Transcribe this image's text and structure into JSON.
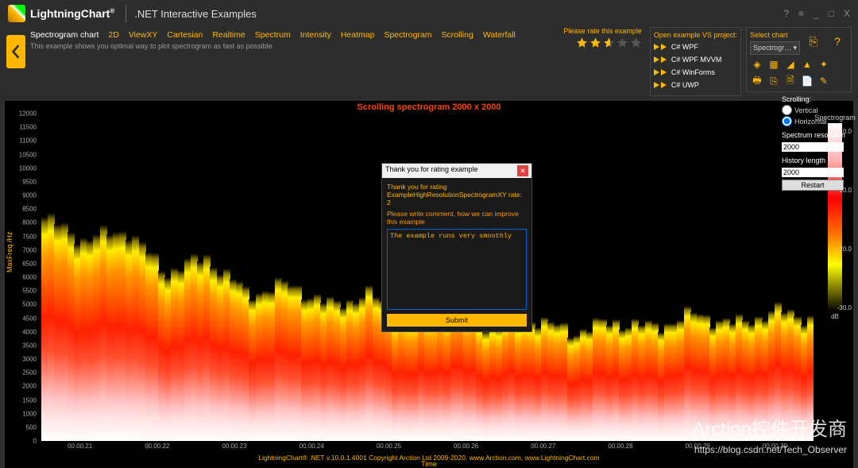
{
  "header": {
    "brand": "LightningChart",
    "brand_sup": "®",
    "app_title": ".NET Interactive Examples",
    "win": [
      "?",
      "≡",
      "_",
      "□",
      "X"
    ]
  },
  "crumbs": [
    "Spectrogram chart",
    "2D",
    "ViewXY",
    "Cartesian",
    "Realtime",
    "Spectrum",
    "Intensity",
    "Heatmap",
    "Spectrogram",
    "Scrolling",
    "Waterfall"
  ],
  "subtitle": "This example shows you optimal way to plot spectrogram as fast as possible.",
  "rating": {
    "label": "Please rate this example",
    "stars": [
      1,
      1,
      0.6,
      0,
      0
    ]
  },
  "open_project": {
    "hdr": "Open example VS project:",
    "opts": [
      "C# WPF",
      "C# WPF MVVM",
      "C# WinForms",
      "C# UWP"
    ]
  },
  "select_chart": {
    "hdr": "Select chart",
    "value": "Spectrogr…"
  },
  "side": {
    "scrolling_label": "Scrolling:",
    "opt1": "Vertical",
    "opt2": "Horizontal",
    "selected": "Horizontal",
    "spec_res_label": "Spectrum resolution",
    "spec_res": "2000",
    "hist_label": "History length",
    "hist": "2000",
    "restart": "Restart"
  },
  "dialog": {
    "title": "Thank you for rating example",
    "line1": "Thank you for rating ExampleHighResolutionSpectrogramXY rate: 2",
    "line2": "Please write comment, how we can improve this example",
    "text": "The example runs very smoothly",
    "submit": "Submit"
  },
  "footer": "LightningChart® .NET v.10.0.1.4001 Copyright Arction Ltd 2009-2020. www.Arction.com, www.LightningChart.com",
  "watermark1": "Arction控件开发商",
  "watermark2": "https://blog.csdn.net/Tech_Observer",
  "chart_data": {
    "type": "heatmap",
    "title": "Scrolling spectrogram 2000 x 2000",
    "xlabel": "Time",
    "ylabel": "MaxFreq /Hz",
    "y_ticks": [
      0,
      500,
      1000,
      1500,
      2000,
      2500,
      3000,
      3500,
      4000,
      4500,
      5000,
      5500,
      6000,
      6500,
      7000,
      7500,
      8000,
      8500,
      9000,
      9500,
      10000,
      10500,
      11000,
      11500,
      12000
    ],
    "x_ticks": [
      "00.00.21",
      "00.00.22",
      "00.00.23",
      "00.00.24",
      "00.00.25",
      "00.00.26",
      "00.00.27",
      "00.00.28",
      "00.00.29",
      "00.00.30"
    ],
    "ylim": [
      0,
      12000
    ],
    "colorbar": {
      "title": "Spectrogram",
      "unit": "dB",
      "ticks": [
        0.0,
        -10.0,
        -20.0,
        -30.0
      ]
    },
    "envelope_upper": [
      8200,
      7400,
      7800,
      6200,
      6800,
      5400,
      5800,
      5000,
      5400,
      4400,
      4900,
      4200,
      4500,
      4000,
      4400,
      4200,
      4700,
      4300,
      4800,
      4500
    ],
    "envelope_lower": [
      0,
      0,
      0,
      0,
      0,
      0,
      0,
      0,
      0,
      0,
      0,
      0,
      0,
      0,
      0,
      0,
      0,
      0,
      0,
      0
    ],
    "note": "Spectrogram intensity: white/pink near 0 dB at low frequencies 500-3500 Hz, transitioning through red (-10), orange, yellow (-20) to black (-30) above envelope. Upper envelope descends from ~8000 Hz at t=21s to ~4500 Hz by t=24s then undulates 4000-4800 Hz."
  }
}
